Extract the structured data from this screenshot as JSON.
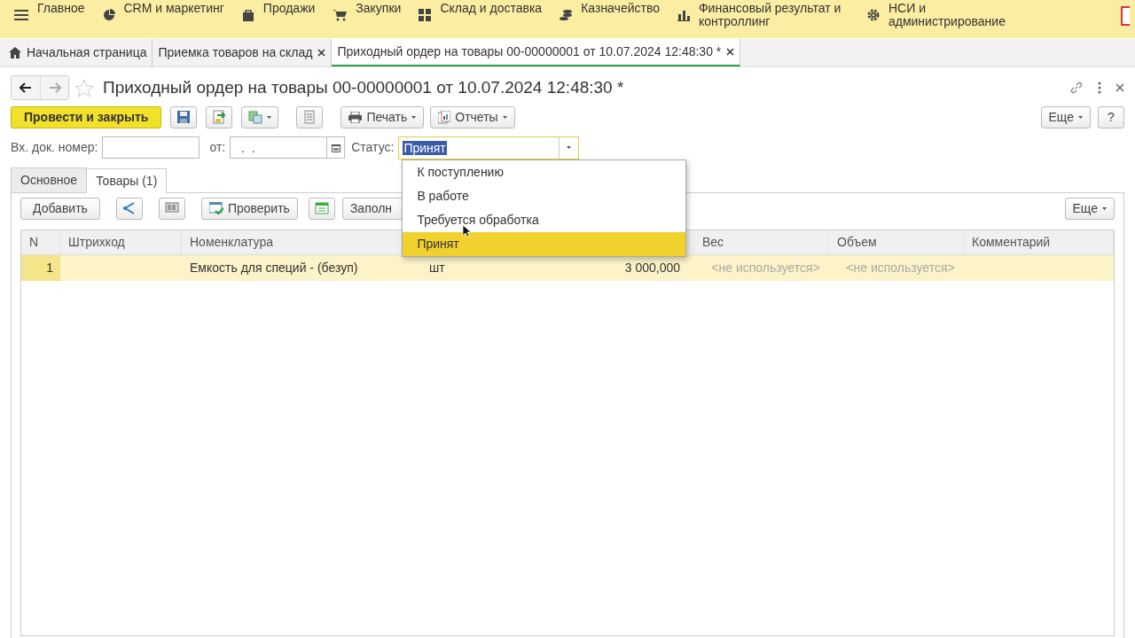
{
  "main_menu": [
    {
      "label": "Главное"
    },
    {
      "label": "CRM и маркетинг"
    },
    {
      "label": "Продажи"
    },
    {
      "label": "Закупки"
    },
    {
      "label": "Склад и доставка"
    },
    {
      "label": "Казначейство"
    },
    {
      "label": "Финансовый результат и контроллинг"
    },
    {
      "label": "НСИ и администрирование"
    }
  ],
  "open_tabs": [
    {
      "label": "Начальная страница",
      "kind": "home",
      "selected": false
    },
    {
      "label": "Приемка товаров на склад",
      "kind": "closable",
      "selected": false
    },
    {
      "label": "Приходный ордер на товары 00-00000001 от 10.07.2024 12:48:30 *",
      "kind": "closable",
      "selected": true
    }
  ],
  "document": {
    "title": "Приходный ордер на товары 00-00000001 от 10.07.2024 12:48:30 *"
  },
  "toolbar": {
    "primary": "Провести и закрыть",
    "print": "Печать",
    "reports": "Отчеты",
    "more": "Еще",
    "help": "?"
  },
  "header_fields": {
    "number_label": "Вх. док. номер:",
    "date_label": "от:",
    "date_value": " .  .",
    "status_label": "Статус:",
    "status_value": "Принят"
  },
  "form_tabs": [
    {
      "label": "Основное",
      "selected": false
    },
    {
      "label": "Товары (1)",
      "selected": true
    }
  ],
  "table_toolbar": {
    "add": "Добавить",
    "check": "Проверить",
    "fill": "Заполн",
    "more": "Еще"
  },
  "table": {
    "columns": [
      {
        "label": "N"
      },
      {
        "label": "Штрихкод"
      },
      {
        "label": "Номенклатура"
      },
      {},
      {},
      {
        "label": "Вес"
      },
      {
        "label": "Объем"
      },
      {
        "label": "Комментарий"
      }
    ],
    "rows": [
      {
        "selected": true,
        "cells": [
          "1",
          null,
          "Емкость для специй - (безуп)",
          "шт",
          "3 000,000",
          "<не используется>",
          "<не используется>",
          null
        ]
      }
    ]
  },
  "status_dropdown": {
    "options": [
      {
        "label": "К поступлению",
        "selected": false
      },
      {
        "label": "В работе",
        "selected": false
      },
      {
        "label": "Требуется обработка",
        "selected": false
      },
      {
        "label": "Принят",
        "selected": true
      }
    ]
  }
}
